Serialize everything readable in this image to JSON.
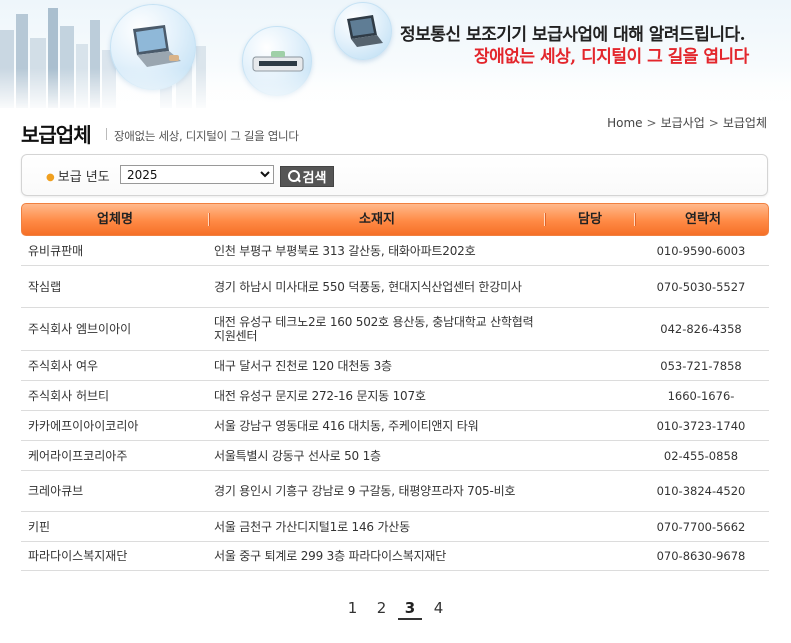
{
  "banner": {
    "line1": "정보통신 보조기기 보급사업에 대해 알려드립니다.",
    "line2": "장애없는 세상, 디지털이 그 길을 엽니다"
  },
  "page": {
    "title": "보급업체",
    "subtitle": "장애없는 세상, 디지털이 그 길을 엽니다"
  },
  "breadcrumb": [
    "Home",
    "보급사업",
    "보급업체"
  ],
  "search": {
    "label": "보급 년도",
    "selected_year": "2025",
    "button_label": "검색"
  },
  "table": {
    "columns": [
      "업체명",
      "소재지",
      "담당",
      "연락처"
    ],
    "rows": [
      {
        "name": "유비큐판매",
        "address": "인천 부평구 부평북로 313  갈산동, 태화아파트202호",
        "manager": "",
        "phone": "010-9590-6003"
      },
      {
        "name": "작심랩",
        "address": "경기 하남시 미사대로 550  덕풍동, 현대지식산업센터 한강미사",
        "manager": "",
        "phone": "070-5030-5527"
      },
      {
        "name": "주식회사 엠브이아이",
        "address": "대전 유성구 테크노2로 160  502호 용산동, 충남대학교 산학협력지원센터",
        "manager": "",
        "phone": "042-826-4358"
      },
      {
        "name": "주식회사 여우",
        "address": "대구 달서구 진천로 120  대천동 3층",
        "manager": "",
        "phone": "053-721-7858"
      },
      {
        "name": "주식회사 허브티",
        "address": "대전 유성구 문지로 272-16  문지동 107호",
        "manager": "",
        "phone": "1660-1676-"
      },
      {
        "name": "카카에프이아이코리아",
        "address": "서울 강남구 영동대로 416  대치동, 주케이티앤지 타워",
        "manager": "",
        "phone": "010-3723-1740"
      },
      {
        "name": "케어라이프코리아주",
        "address": "서울특별시 강동구 선사로 50  1층",
        "manager": "",
        "phone": "02-455-0858"
      },
      {
        "name": "크레아큐브",
        "address": "경기 용인시 기흥구 강남로 9  구갈동, 태평양프라자 705-비호",
        "manager": "",
        "phone": "010-3824-4520"
      },
      {
        "name": "키핀",
        "address": "서울 금천구 가산디지털1로 146  가산동",
        "manager": "",
        "phone": "070-7700-5662"
      },
      {
        "name": "파라다이스복지재단",
        "address": "서울 중구 퇴계로 299  3층 파라다이스복지재단",
        "manager": "",
        "phone": "070-8630-9678"
      }
    ]
  },
  "pagination": {
    "pages": [
      "1",
      "2",
      "3",
      "4"
    ],
    "current": "3"
  }
}
